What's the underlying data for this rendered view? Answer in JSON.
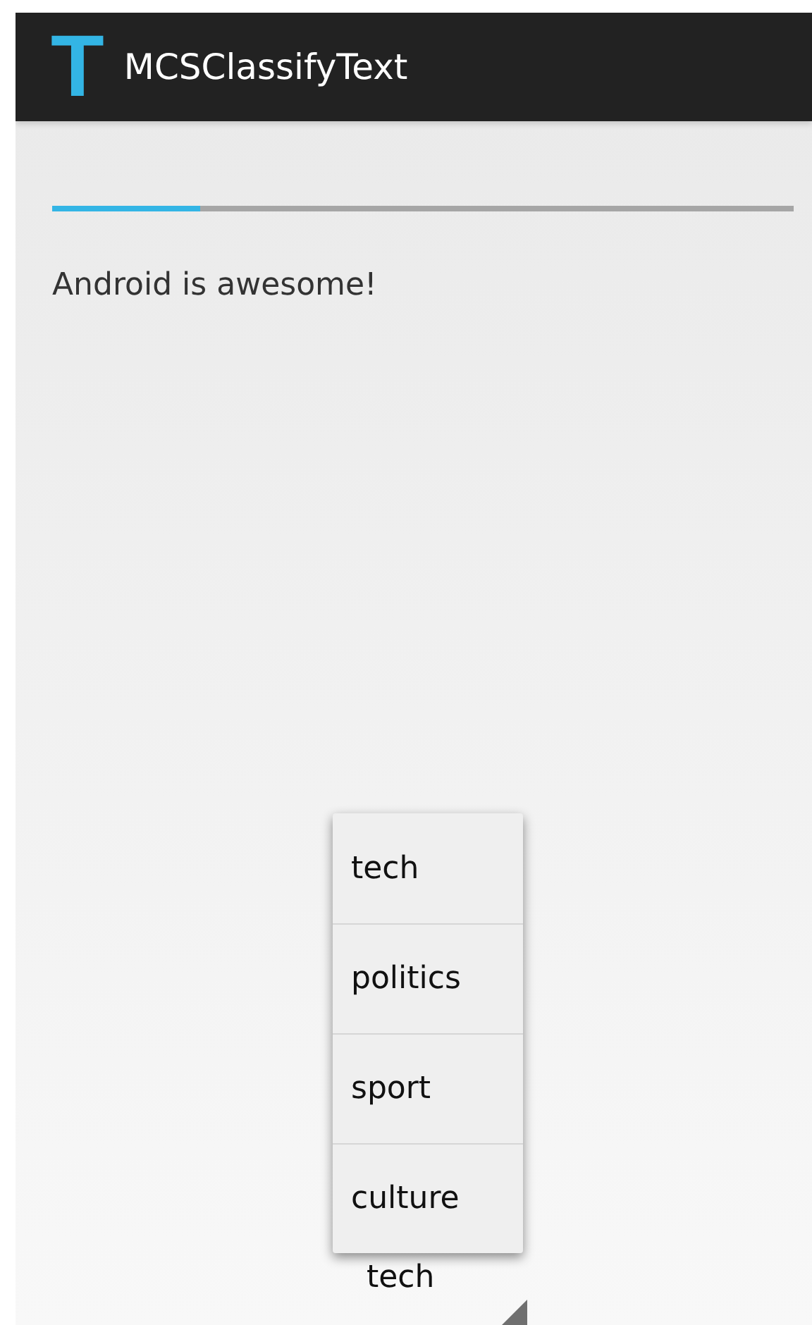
{
  "app_bar": {
    "logo": "T",
    "title": "MCSClassifyText"
  },
  "progress": {
    "level": 0.2
  },
  "text": "Android is awesome!",
  "spinner": {
    "value": "tech",
    "expanded": true
  },
  "dropdown": {
    "items": [
      {
        "label": "tech"
      },
      {
        "label": "politics"
      },
      {
        "label": "sport"
      },
      {
        "label": "culture"
      }
    ]
  }
}
